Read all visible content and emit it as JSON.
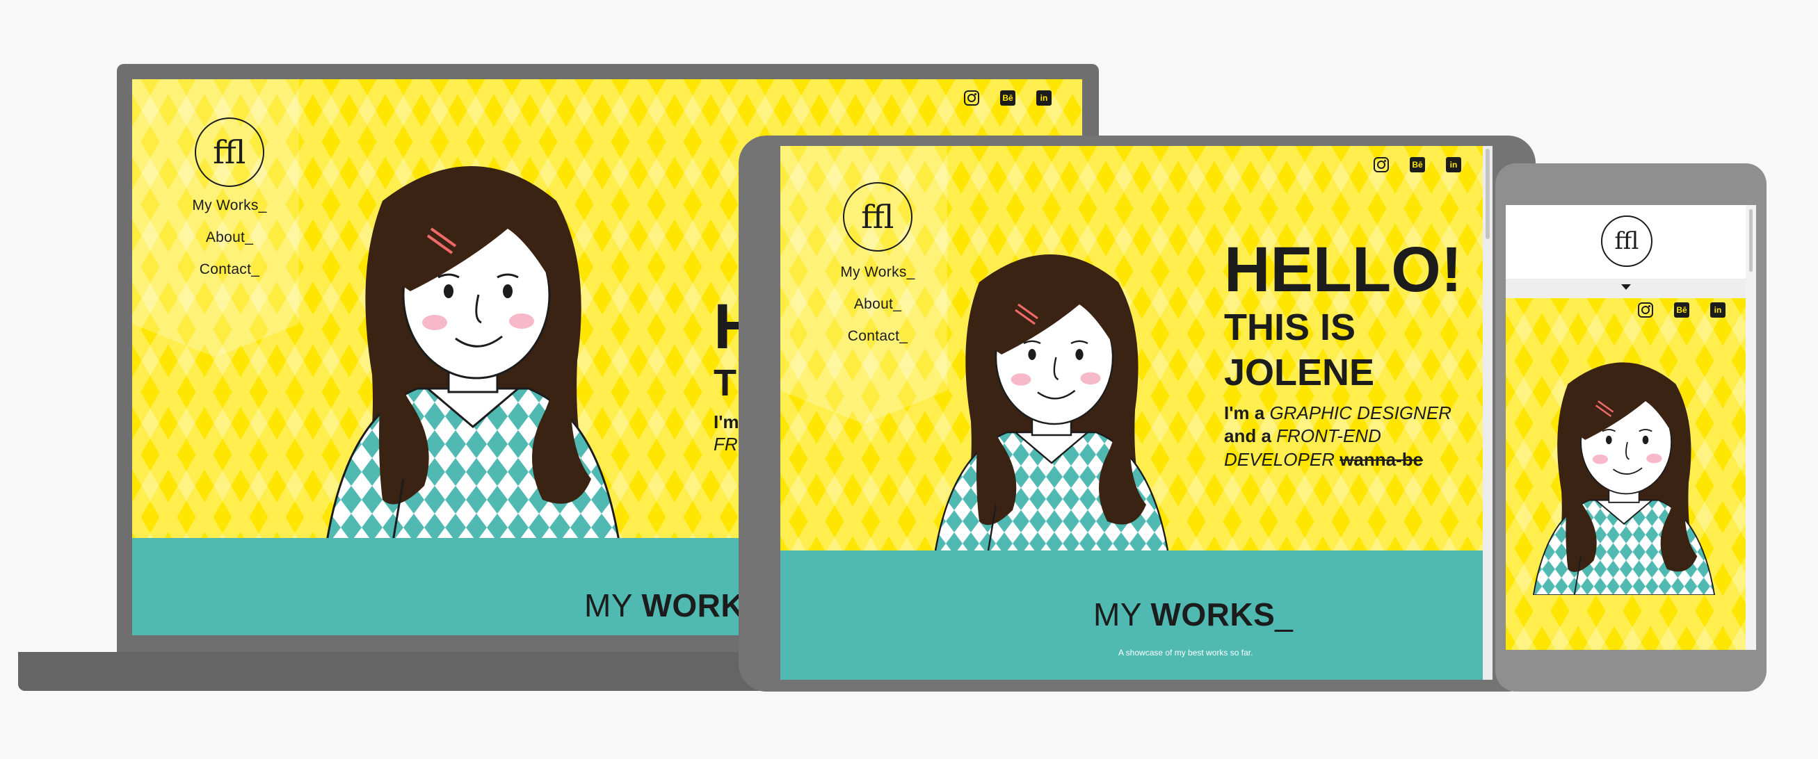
{
  "site": {
    "logo_glyph": "ﬄ",
    "nav": [
      "My Works_",
      "About_",
      "Contact_"
    ],
    "social_icons": [
      "instagram-icon",
      "behance-icon",
      "linkedin-icon"
    ],
    "behance_label": "Bē",
    "linkedin_label": "in",
    "hero": {
      "hello": "HELLO!",
      "this_is": "THIS IS",
      "name": "JOLENE",
      "im_a": "I'm a",
      "role1": "GRAPHIC DESIGNER",
      "and_a": "and a",
      "role2_part1": "FRONT-END",
      "role2_part2": "DEVELOPER",
      "wannabe": "wanna-be"
    },
    "works": {
      "title_light": "MY",
      "title_bold": "WORKS",
      "title_suffix": "_",
      "subtitle": "A showcase of my best works so far."
    },
    "laptop_partial": {
      "hello": "H",
      "this_is": "T",
      "im": "I'm",
      "fro": "FRO"
    }
  },
  "colors": {
    "yellow": "#ffe600",
    "teal": "#4fb9b2",
    "hair": "#3b2314",
    "text": "#1c1c1c",
    "device_laptop": "#6f6f6f",
    "device_tablet": "#747474",
    "device_phone": "#8f8f8f"
  }
}
